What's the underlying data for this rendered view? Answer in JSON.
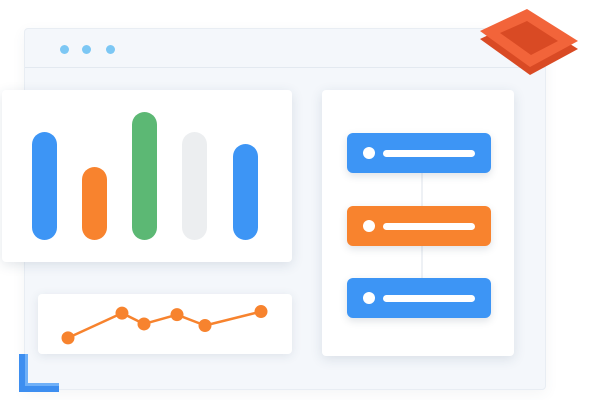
{
  "window": {
    "dot_color": "#7cc7f4",
    "background": "#f4f7fb"
  },
  "bar_panel": {
    "bars": [
      {
        "level": 0.84,
        "color": "#3d95f5"
      },
      {
        "level": 0.57,
        "color": "#f8832e"
      },
      {
        "level": 1.0,
        "color": "#5cb874"
      },
      {
        "level": 0.84,
        "color": "#eceef0"
      },
      {
        "level": 0.75,
        "color": "#3d95f5"
      }
    ]
  },
  "line_panel": {
    "values": [
      0.1,
      0.9,
      0.55,
      0.85,
      0.5,
      0.95
    ],
    "color": "#f7832e"
  },
  "list_panel": {
    "items": [
      {
        "color": "#3d95f5"
      },
      {
        "color": "#f8832e"
      },
      {
        "color": "#3d95f5"
      }
    ]
  },
  "decorations": {
    "frame_color": "#f2643a",
    "corner_color": "#3d8ef0"
  }
}
